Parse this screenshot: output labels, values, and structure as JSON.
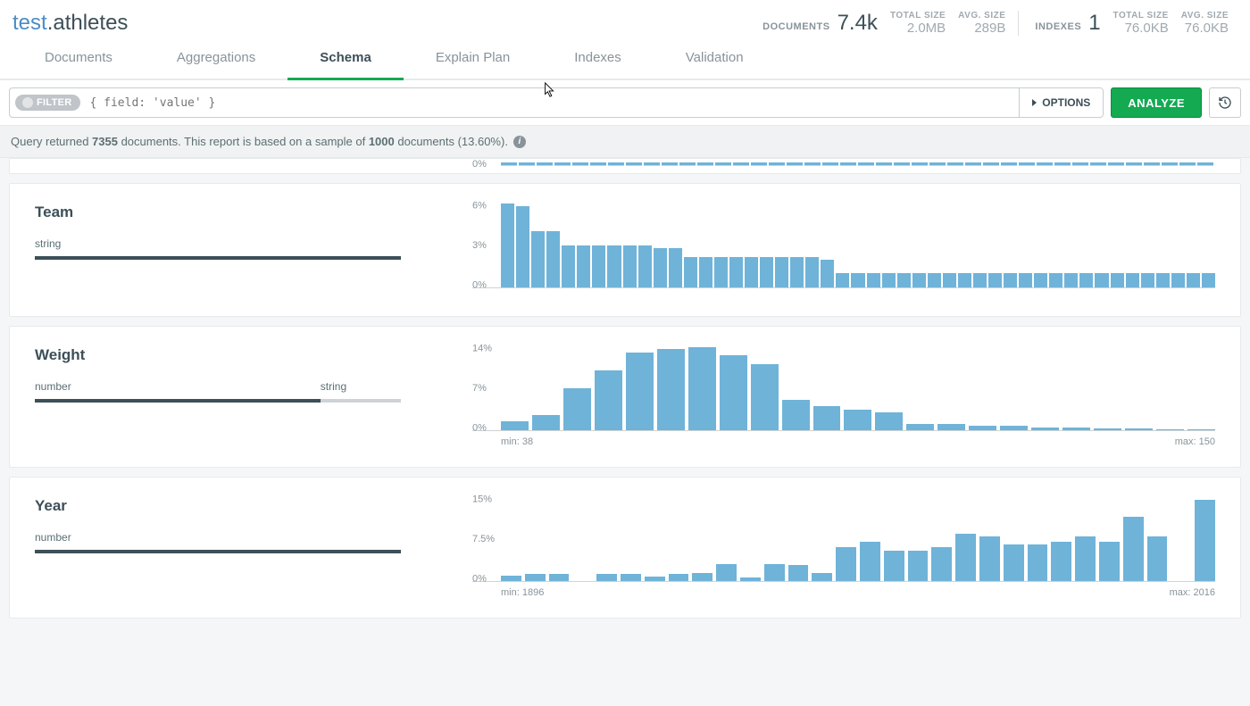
{
  "namespace": {
    "db": "test",
    "collection": ".athletes"
  },
  "stats": {
    "documents_label": "DOCUMENTS",
    "documents_value": "7.4k",
    "total_size_label": "TOTAL SIZE",
    "total_size_value": "2.0MB",
    "avg_size_label": "AVG. SIZE",
    "avg_size_value": "289B",
    "indexes_label": "INDEXES",
    "indexes_value": "1",
    "idx_total_size_label": "TOTAL SIZE",
    "idx_total_size_value": "76.0KB",
    "idx_avg_size_label": "AVG. SIZE",
    "idx_avg_size_value": "76.0KB"
  },
  "tabs": {
    "documents": "Documents",
    "aggregations": "Aggregations",
    "schema": "Schema",
    "explain": "Explain Plan",
    "indexes": "Indexes",
    "validation": "Validation"
  },
  "querybar": {
    "filter_label": "FILTER",
    "placeholder": "{ field: 'value' }",
    "options": "OPTIONS",
    "analyze": "ANALYZE"
  },
  "result_text": {
    "pre": "Query returned ",
    "count": "7355",
    "mid": " documents. This report is based on a sample of ",
    "sample": "1000",
    "post": " documents (13.60%)."
  },
  "fields": {
    "team": {
      "name": "Team",
      "types": [
        {
          "label": "string",
          "width": 100,
          "dark": true
        }
      ]
    },
    "weight": {
      "name": "Weight",
      "types": [
        {
          "label": "number",
          "width": 78,
          "dark": true
        },
        {
          "label": "string",
          "width": 22,
          "dark": false
        }
      ],
      "min_label": "min: 38",
      "max_label": "max: 150"
    },
    "year": {
      "name": "Year",
      "types": [
        {
          "label": "number",
          "width": 100,
          "dark": true
        }
      ],
      "min_label": "min: 1896",
      "max_label": "max: 2016"
    }
  },
  "chart_data": [
    {
      "field": "Team",
      "type": "bar",
      "ylabel": "%",
      "yticks": [
        "6%",
        "3%",
        "0%"
      ],
      "ylim": [
        0,
        6
      ],
      "values": [
        6.0,
        5.8,
        4.0,
        4.0,
        3.0,
        3.0,
        3.0,
        3.0,
        3.0,
        3.0,
        2.8,
        2.8,
        2.2,
        2.2,
        2.2,
        2.2,
        2.2,
        2.2,
        2.2,
        2.2,
        2.2,
        2.0,
        1.0,
        1.0,
        1.0,
        1.0,
        1.0,
        1.0,
        1.0,
        1.0,
        1.0,
        1.0,
        1.0,
        1.0,
        1.0,
        1.0,
        1.0,
        1.0,
        1.0,
        1.0,
        1.0,
        1.0,
        1.0,
        1.0,
        1.0,
        1.0,
        1.0
      ]
    },
    {
      "field": "Weight",
      "type": "bar",
      "ylabel": "%",
      "yticks": [
        "14%",
        "7%",
        "0%"
      ],
      "ylim": [
        0,
        14
      ],
      "min": 38,
      "max": 150,
      "values": [
        1.5,
        2.5,
        7.0,
        10.0,
        13.0,
        13.5,
        13.8,
        12.5,
        11.0,
        5.0,
        4.0,
        3.5,
        3.0,
        1.0,
        1.0,
        0.7,
        0.7,
        0.5,
        0.5,
        0.3,
        0.3,
        0.2,
        0.2
      ]
    },
    {
      "field": "Year",
      "type": "bar",
      "ylabel": "%",
      "yticks": [
        "15%",
        "7.5%",
        "0%"
      ],
      "ylim": [
        0,
        15
      ],
      "min": 1896,
      "max": 2016,
      "values": [
        1.0,
        1.2,
        1.3,
        0.0,
        1.3,
        1.3,
        0.8,
        1.3,
        1.5,
        3.0,
        0.6,
        3.0,
        2.8,
        1.5,
        6.0,
        7.0,
        5.5,
        5.5,
        6.0,
        8.5,
        8.0,
        6.5,
        6.5,
        7.0,
        8.0,
        7.0,
        11.5,
        8.0,
        0.0,
        14.5
      ]
    }
  ]
}
